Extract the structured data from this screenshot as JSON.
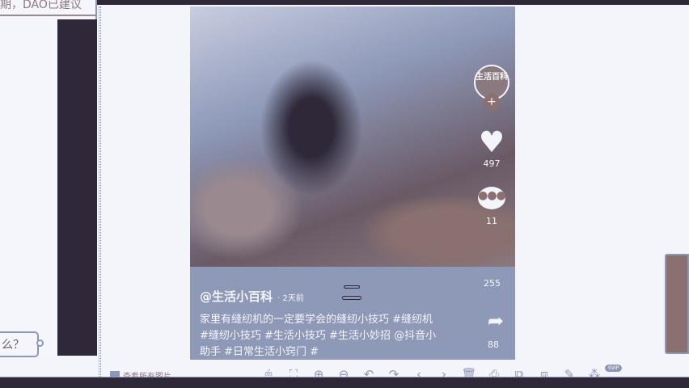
{
  "left": {
    "title": "期，DAO已建议",
    "bubble_text": "么？"
  },
  "post": {
    "avatar_text": "生活百科",
    "plus": "+",
    "likes": "497",
    "comments": "11",
    "favorites": "255",
    "shares": "88",
    "username": "@生活小百科",
    "time": "· 2天前",
    "caption": "家里有缝纫机的一定要学会的缝纫小技巧 #缝纫机 #缝纫小技巧 #生活小技巧 #生活小妙招 @抖音小助手 #日常生活小窍门 #"
  },
  "viewer": {
    "view_all": "查看所有图片",
    "badge": "SVIP",
    "toolbar": [
      {
        "icon": "mouse-icon",
        "glyph": "🖱"
      },
      {
        "icon": "fit-screen-icon",
        "glyph": "⛶"
      },
      {
        "icon": "zoom-in-icon",
        "glyph": "⊕"
      },
      {
        "icon": "zoom-out-icon",
        "glyph": "⊖"
      },
      {
        "icon": "rotate-left-icon",
        "glyph": "↶"
      },
      {
        "icon": "rotate-right-icon",
        "glyph": "↷"
      },
      {
        "icon": "previous-icon",
        "glyph": "‹"
      },
      {
        "icon": "next-icon",
        "glyph": "›"
      },
      {
        "icon": "delete-icon",
        "glyph": "🗑"
      },
      {
        "icon": "print-icon",
        "glyph": "⎙"
      },
      {
        "icon": "copy-icon",
        "glyph": "⧉"
      },
      {
        "icon": "export-icon",
        "glyph": "⧈"
      },
      {
        "icon": "edit-icon",
        "glyph": "✎"
      },
      {
        "icon": "more-icon",
        "glyph": "⁂"
      }
    ]
  },
  "colors": {
    "dark": "#2e2838",
    "accent": "#8d97b8",
    "brown": "#8a706e",
    "bg": "#f4f5fb"
  }
}
